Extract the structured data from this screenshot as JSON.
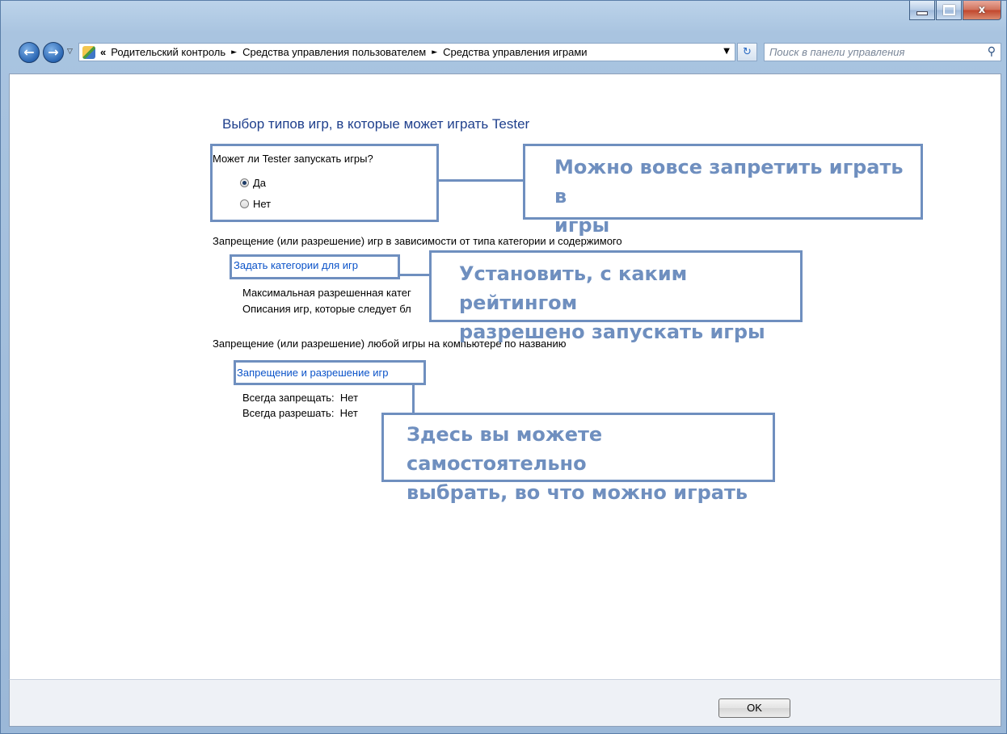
{
  "window": {
    "controls": {
      "minimize_icon": "minimize-icon",
      "maximize_icon": "maximize-icon",
      "close_label": "x"
    }
  },
  "nav": {
    "back_icon": "←",
    "forward_icon": "→",
    "dropdown_icon": "▽",
    "breadcrumb_chevron": "«",
    "breadcrumbs": [
      "Родительский контроль",
      "Средства управления пользователем",
      "Средства управления играми"
    ],
    "separator": "►",
    "address_dropdown": "▼",
    "refresh_icon": "↻",
    "search_placeholder": "Поиск в панели управления",
    "search_icon": "⚲"
  },
  "main": {
    "title": "Выбор типов игр, в которые может играть Tester",
    "can_play_question": "Может ли Tester запускать игры?",
    "radio_yes": "Да",
    "radio_no": "Нет",
    "section1_heading": "Запрещение (или разрешение) игр в зависимости от типа категории и содержимого",
    "set_categories_link": "Задать категории для игр",
    "max_category_text": "Максимальная разрешенная катег",
    "descriptions_text": "Описания игр, которые следует бл",
    "section2_heading": "Запрещение (или разрешение) любой игры на компьютере по названию",
    "block_allow_link": "Запрещение и разрешение игр",
    "always_block_label": "Всегда запрещать:",
    "always_block_value": "Нет",
    "always_allow_label": "Всегда разрешать:",
    "always_allow_value": "Нет"
  },
  "footer": {
    "ok_label": "OK"
  },
  "annotations": {
    "callout1_line1": "Можно вовсе запретить играть в",
    "callout1_line2": "игры",
    "callout2_line1": "Установить, с каким рейтингом",
    "callout2_line2": "разрешено запускать игры",
    "callout3_line1": "Здесь вы можете самостоятельно",
    "callout3_line2": "выбрать, во что можно играть",
    "accent_color": "#6f8fbf"
  }
}
